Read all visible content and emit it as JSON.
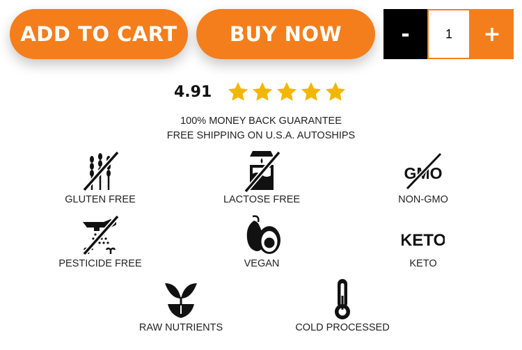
{
  "buttons": {
    "add_to_cart": "ADD TO CART",
    "buy_now": "BUY NOW"
  },
  "quantity": {
    "minus": "-",
    "value": "1",
    "plus": "+"
  },
  "rating": {
    "score": "4.91",
    "stars": 5
  },
  "guarantee": {
    "line1": "100% MONEY BACK GUARANTEE",
    "line2": "FREE SHIPPING ON U.S.A. AUTOSHIPS"
  },
  "features": {
    "gluten_free": "GLUTEN FREE",
    "lactose_free": "LACTOSE FREE",
    "non_gmo": "NON-GMO",
    "pesticide_free": "PESTICIDE FREE",
    "vegan": "VEGAN",
    "keto": "KETO",
    "raw_nutrients": "RAW NUTRIENTS",
    "cold_processed": "COLD PROCESSED",
    "gmo_icon_text": "GMO",
    "keto_icon_text": "KETO"
  },
  "colors": {
    "accent": "#f47e1b",
    "star": "#f2b705"
  }
}
